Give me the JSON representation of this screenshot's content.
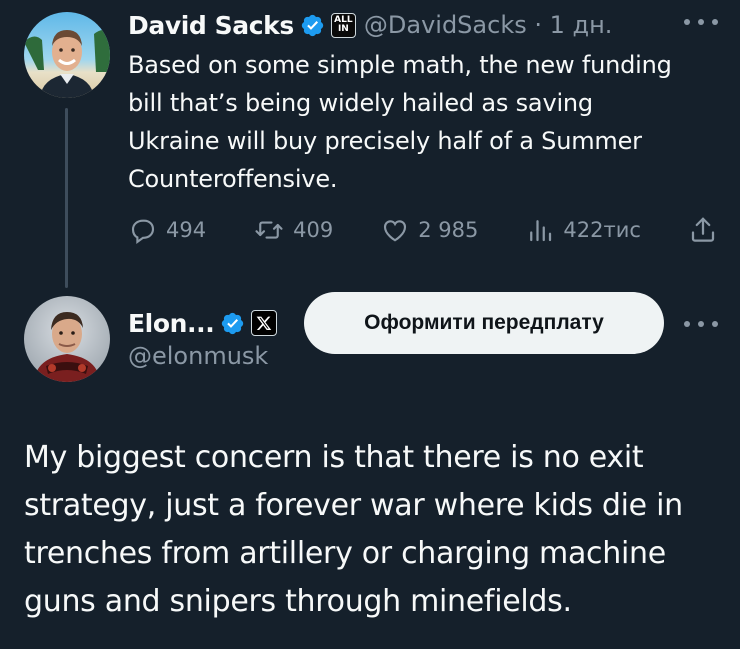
{
  "tweet1": {
    "author_name": "David Sacks",
    "affiliate_badge_line1": "ALL",
    "affiliate_badge_line2": "IN",
    "handle_and_time": "@DavidSacks · 1 дн.",
    "text": "Based on some simple math, the new funding bill that’s being widely hailed as saving Ukraine will buy precisely half of a Summer Counteroffensive.",
    "replies": "494",
    "reposts": "409",
    "likes": "2 985",
    "views": "422тис"
  },
  "tweet2": {
    "author_name": "Elon...",
    "handle": "@elonmusk",
    "subscribe_label": "Оформити передплату",
    "text": "My biggest concern is that there is no exit strategy, just a forever war where kids die in trenches from artillery or charging machine guns and snipers through minefields."
  },
  "colors": {
    "background": "#15202b",
    "text": "#f7f9f9",
    "secondary_text": "#8b98a5",
    "verified": "#1d9bf0",
    "button_bg": "#eff3f4"
  },
  "icons": [
    "verified-badge-icon",
    "all-in-affiliate-badge",
    "x-affiliate-badge",
    "more-icon",
    "reply-icon",
    "repost-icon",
    "like-icon",
    "views-icon",
    "share-icon"
  ]
}
